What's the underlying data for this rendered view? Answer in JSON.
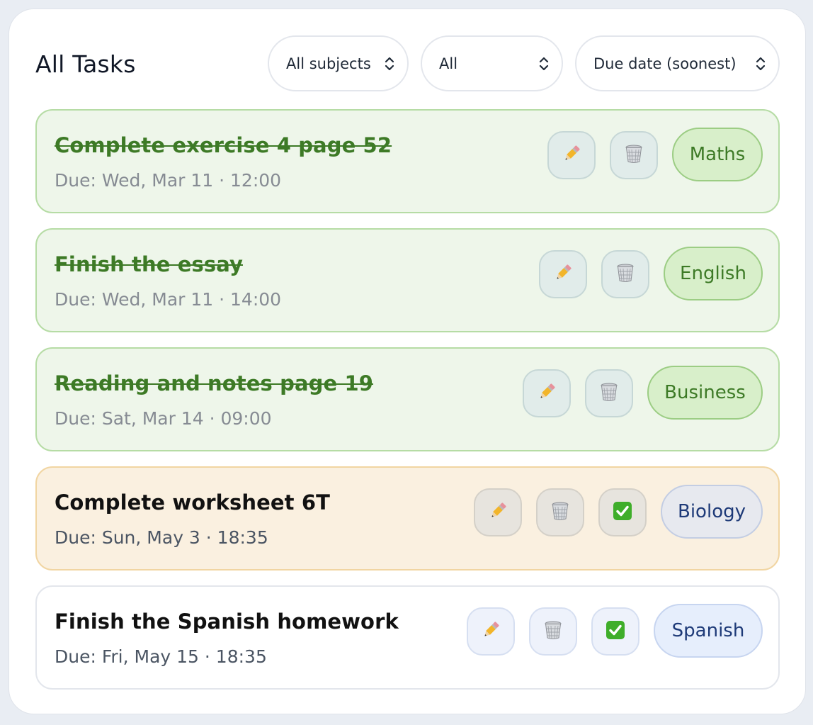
{
  "header": {
    "title": "All Tasks",
    "filter_subject": "All subjects",
    "filter_status": "All",
    "sort": "Due date (soonest)"
  },
  "tasks": [
    {
      "title": "Complete exercise 4 page 52",
      "due": "Due: Wed, Mar 11 · 12:00",
      "subject": "Maths",
      "state": "completed"
    },
    {
      "title": "Finish the essay",
      "due": "Due: Wed, Mar 11 · 14:00",
      "subject": "English",
      "state": "completed"
    },
    {
      "title": "Reading and notes page 19",
      "due": "Due: Sat, Mar 14 · 09:00",
      "subject": "Business",
      "state": "completed"
    },
    {
      "title": "Complete worksheet 6T",
      "due": "Due: Sun, May 3 · 18:35",
      "subject": "Biology",
      "state": "due-soon"
    },
    {
      "title": "Finish the Spanish homework",
      "due": "Due: Fri, May 15 · 18:35",
      "subject": "Spanish",
      "state": "open"
    }
  ],
  "icons": {
    "edit": "pencil-icon",
    "delete": "wastebasket-icon",
    "complete": "check-mark-icon"
  },
  "colors": {
    "completed_bg": "#eef6ea",
    "completed_text": "#3d7a26",
    "due_soon_bg": "#faf0e0",
    "badge_blue_text": "#1e3a78"
  }
}
